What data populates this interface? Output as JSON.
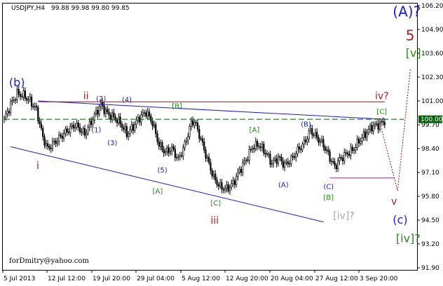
{
  "header": {
    "symbol_text": "USDJPY,H4",
    "ohlc_text": "99.88 99.98 99.80 99.85"
  },
  "footer": {
    "credit": "forDmitry@yahoo.com"
  },
  "colors": {
    "background": "#ffffff",
    "candle": "#000000",
    "wave_blue": "#1a1ad4",
    "wave_green": "#2a8a1a",
    "wave_darkred": "#a82020",
    "wave_gray": "#a9a9a9",
    "red_line": "#c00000",
    "magenta_line": "#cc00cc",
    "price_line": "#006400"
  },
  "chart_data": {
    "type": "candlestick",
    "ylim": [
      91.9,
      106.2
    ],
    "y_ticks": [
      "106.20",
      "104.90",
      "103.60",
      "102.30",
      "101.00",
      "99.70",
      "98.40",
      "97.10",
      "95.80",
      "94.50",
      "93.20",
      "91.90"
    ],
    "x_ticks": [
      "5 Jul 2013",
      "12 Jul 12:00",
      "19 Jul 20:00",
      "29 Jul 04:00",
      "5 Aug 12:00",
      "12 Aug 20:00",
      "20 Aug 04:00",
      "27 Aug 12:00",
      "3 Sep 20:00"
    ],
    "current_price": "100.00",
    "path": [
      [
        0,
        100.0
      ],
      [
        4,
        100.8
      ],
      [
        8,
        101.4
      ],
      [
        12,
        101.3
      ],
      [
        16,
        101.0
      ],
      [
        20,
        100.5
      ],
      [
        24,
        99.0
      ],
      [
        27,
        98.4
      ],
      [
        32,
        98.8
      ],
      [
        38,
        99.3
      ],
      [
        44,
        99.7
      ],
      [
        50,
        99.2
      ],
      [
        56,
        100.2
      ],
      [
        60,
        100.8
      ],
      [
        64,
        100.3
      ],
      [
        68,
        100.1
      ],
      [
        72,
        99.8
      ],
      [
        76,
        99.2
      ],
      [
        80,
        99.6
      ],
      [
        84,
        100.1
      ],
      [
        88,
        100.4
      ],
      [
        92,
        99.8
      ],
      [
        96,
        98.6
      ],
      [
        100,
        98.2
      ],
      [
        104,
        98.4
      ],
      [
        108,
        97.8
      ],
      [
        112,
        98.6
      ],
      [
        116,
        99.8
      ],
      [
        118,
        99.9
      ],
      [
        122,
        98.9
      ],
      [
        126,
        97.8
      ],
      [
        130,
        96.8
      ],
      [
        134,
        96.3
      ],
      [
        138,
        96.2
      ],
      [
        142,
        96.5
      ],
      [
        146,
        97.2
      ],
      [
        150,
        97.8
      ],
      [
        154,
        98.5
      ],
      [
        158,
        98.6
      ],
      [
        162,
        98.2
      ],
      [
        166,
        97.6
      ],
      [
        170,
        97.9
      ],
      [
        174,
        97.5
      ],
      [
        178,
        97.8
      ],
      [
        182,
        98.3
      ],
      [
        186,
        98.7
      ],
      [
        190,
        99.4
      ],
      [
        194,
        99.0
      ],
      [
        198,
        98.6
      ],
      [
        202,
        97.9
      ],
      [
        205,
        97.4
      ],
      [
        208,
        97.8
      ],
      [
        212,
        98.1
      ],
      [
        216,
        98.3
      ],
      [
        220,
        98.8
      ],
      [
        224,
        99.2
      ],
      [
        228,
        99.6
      ],
      [
        232,
        99.7
      ],
      [
        236,
        99.9
      ]
    ],
    "lines": [
      {
        "name": "blue-upper-trendline",
        "color": "wave_blue",
        "width": 1,
        "dash": "",
        "points": [
          [
            21,
            101.0
          ],
          [
            236,
            100.0
          ]
        ]
      },
      {
        "name": "blue-lower-trendline",
        "color": "wave_blue",
        "width": 1,
        "dash": "",
        "points": [
          [
            4,
            98.5
          ],
          [
            198,
            94.4
          ]
        ]
      },
      {
        "name": "red-resistance-line",
        "color": "red_line",
        "width": 1,
        "dash": "",
        "points": [
          [
            21,
            100.95
          ],
          [
            236,
            100.95
          ]
        ]
      },
      {
        "name": "magenta-support-line",
        "color": "magenta_line",
        "width": 1,
        "dash": "",
        "points": [
          [
            202,
            96.8
          ],
          [
            242,
            96.8
          ]
        ]
      },
      {
        "name": "current-price-line",
        "color": "price_line",
        "width": 1,
        "dash": "8,4",
        "points": [
          [
            0,
            100.0
          ],
          [
            248,
            100.0
          ]
        ]
      },
      {
        "name": "projection-down-line",
        "color": "red_line",
        "width": 1,
        "dash": "2,2",
        "points": [
          [
            233,
            99.8
          ],
          [
            244,
            96.1
          ]
        ]
      },
      {
        "name": "projection-up-line",
        "color": "red_line",
        "width": 1,
        "dash": "2,2",
        "points": [
          [
            244,
            96.1
          ],
          [
            252,
            102.8
          ]
        ]
      }
    ],
    "annotations": [
      {
        "text": "(A)?",
        "t": 241,
        "p": 105.6,
        "color": "wave_blue",
        "size": 20
      },
      {
        "text": "5",
        "t": 249,
        "p": 104.3,
        "color": "wave_darkred",
        "size": 20
      },
      {
        "text": "[v]",
        "t": 249,
        "p": 103.4,
        "color": "wave_green",
        "size": 16
      },
      {
        "text": "(b)",
        "t": 3,
        "p": 101.8,
        "color": "wave_blue",
        "size": 16
      },
      {
        "text": "ii",
        "t": 49,
        "p": 101.1,
        "color": "wave_darkred",
        "size": 14
      },
      {
        "text": "(2)",
        "t": 57,
        "p": 101.0,
        "color": "wave_blue",
        "size": 10
      },
      {
        "text": "(4)",
        "t": 73,
        "p": 100.95,
        "color": "wave_blue",
        "size": 10
      },
      {
        "text": "[B]",
        "t": 104,
        "p": 100.6,
        "color": "wave_green",
        "size": 10
      },
      {
        "text": "iv?",
        "t": 230,
        "p": 101.1,
        "color": "wave_darkred",
        "size": 14
      },
      {
        "text": "[C]",
        "t": 231,
        "p": 100.3,
        "color": "wave_green",
        "size": 10
      },
      {
        "text": "(1)",
        "t": 54,
        "p": 99.3,
        "color": "wave_blue",
        "size": 10
      },
      {
        "text": "(3)",
        "t": 64,
        "p": 98.6,
        "color": "wave_blue",
        "size": 10
      },
      {
        "text": "[A]",
        "t": 152,
        "p": 99.3,
        "color": "wave_green",
        "size": 10
      },
      {
        "text": "(B)",
        "t": 184,
        "p": 99.6,
        "color": "wave_blue",
        "size": 10
      },
      {
        "text": "i",
        "t": 20,
        "p": 97.3,
        "color": "wave_darkred",
        "size": 14
      },
      {
        "text": "(5)",
        "t": 95,
        "p": 97.1,
        "color": "wave_blue",
        "size": 10
      },
      {
        "text": "(A)",
        "t": 170,
        "p": 96.3,
        "color": "wave_blue",
        "size": 10
      },
      {
        "text": "(C)",
        "t": 198,
        "p": 96.2,
        "color": "wave_blue",
        "size": 10
      },
      {
        "text": "[A]",
        "t": 92,
        "p": 95.95,
        "color": "wave_green",
        "size": 10
      },
      {
        "text": "[B]",
        "t": 198,
        "p": 95.6,
        "color": "wave_green",
        "size": 10
      },
      {
        "text": "[C]",
        "t": 128,
        "p": 95.3,
        "color": "wave_green",
        "size": 10
      },
      {
        "text": "v",
        "t": 240,
        "p": 95.35,
        "color": "wave_darkred",
        "size": 14
      },
      {
        "text": "iii",
        "t": 128,
        "p": 94.3,
        "color": "wave_darkred",
        "size": 14
      },
      {
        "text": "[iv]?",
        "t": 204,
        "p": 94.55,
        "color": "wave_gray",
        "size": 14
      },
      {
        "text": "(c)",
        "t": 241,
        "p": 94.3,
        "color": "wave_blue",
        "size": 16
      },
      {
        "text": "[iv]?",
        "t": 243,
        "p": 93.3,
        "color": "wave_green",
        "size": 16
      }
    ]
  }
}
